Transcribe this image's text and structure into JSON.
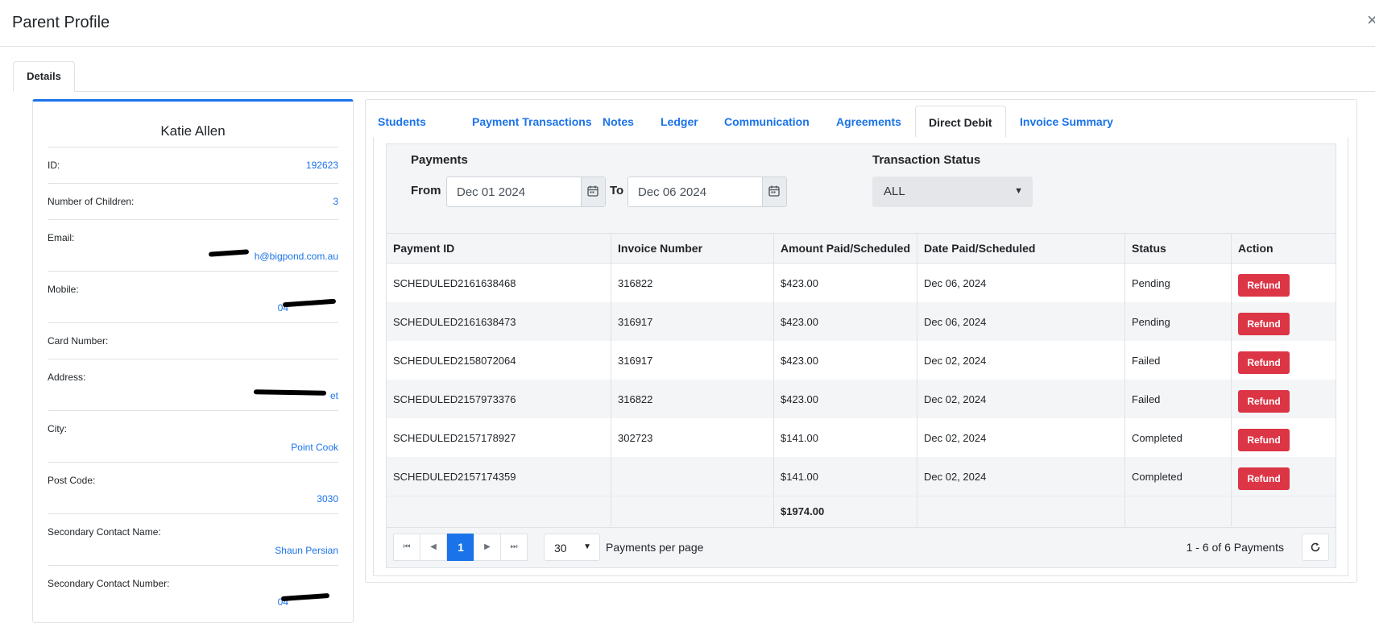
{
  "header": {
    "title": "Parent Profile",
    "close_icon": "×"
  },
  "top_tabs": [
    {
      "label": "Details"
    }
  ],
  "profile": {
    "name": "Katie Allen",
    "fields": [
      {
        "label": "ID:",
        "value": "192623"
      },
      {
        "label": "Number of Children:",
        "value": "3"
      },
      {
        "label": "Email:",
        "value": "h@bigpond.com.au"
      },
      {
        "label": "Mobile:",
        "value": "04"
      },
      {
        "label": "Card Number:",
        "value": ""
      },
      {
        "label": "Address:",
        "value": "et"
      },
      {
        "label": "City:",
        "value": "Point Cook"
      },
      {
        "label": "Post Code:",
        "value": "3030"
      },
      {
        "label": "Secondary Contact Name:",
        "value": "Shaun Persian"
      },
      {
        "label": "Secondary Contact Number:",
        "value": "04"
      }
    ]
  },
  "tabs": [
    {
      "label": "Students"
    },
    {
      "label": "Payment Transactions"
    },
    {
      "label": "Notes"
    },
    {
      "label": "Ledger"
    },
    {
      "label": "Communication"
    },
    {
      "label": "Agreements"
    },
    {
      "label": "Direct Debit",
      "active": true
    },
    {
      "label": "Invoice Summary"
    }
  ],
  "filters": {
    "payments_title": "Payments",
    "from_label": "From",
    "from_value": "Dec 01 2024",
    "to_label": "To",
    "to_value": "Dec 06 2024",
    "status_title": "Transaction Status",
    "status_value": "ALL"
  },
  "table": {
    "columns": [
      "Payment ID",
      "Invoice Number",
      "Amount Paid/Scheduled",
      "Date Paid/Scheduled",
      "Status",
      "Action"
    ],
    "rows": [
      {
        "payment_id": "SCHEDULED2161638468",
        "invoice": "316822",
        "amount": "$423.00",
        "date": "Dec 06, 2024",
        "status": "Pending",
        "action": "Refund"
      },
      {
        "payment_id": "SCHEDULED2161638473",
        "invoice": "316917",
        "amount": "$423.00",
        "date": "Dec 06, 2024",
        "status": "Pending",
        "action": "Refund"
      },
      {
        "payment_id": "SCHEDULED2158072064",
        "invoice": "316917",
        "amount": "$423.00",
        "date": "Dec 02, 2024",
        "status": "Failed",
        "action": "Refund"
      },
      {
        "payment_id": "SCHEDULED2157973376",
        "invoice": "316822",
        "amount": "$423.00",
        "date": "Dec 02, 2024",
        "status": "Failed",
        "action": "Refund"
      },
      {
        "payment_id": "SCHEDULED2157178927",
        "invoice": "302723",
        "amount": "$141.00",
        "date": "Dec 02, 2024",
        "status": "Completed",
        "action": "Refund"
      },
      {
        "payment_id": "SCHEDULED2157174359",
        "invoice": "",
        "amount": "$141.00",
        "date": "Dec 02, 2024",
        "status": "Completed",
        "action": "Refund"
      }
    ],
    "total": "$1974.00"
  },
  "pager": {
    "current_page": "1",
    "per_page": "30",
    "per_page_label": "Payments per page",
    "summary": "1 - 6 of 6 Payments"
  },
  "colors": {
    "accent": "#1a73e8",
    "danger": "#dc3545"
  }
}
